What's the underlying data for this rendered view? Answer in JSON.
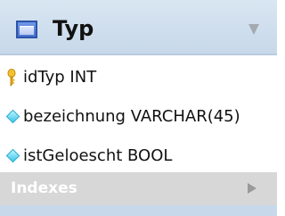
{
  "table": {
    "name": "Typ",
    "icon": "table-icon",
    "collapse_icon": "collapse-arrow-icon"
  },
  "columns": [
    {
      "label": "idTyp INT",
      "icon": "primary-key-icon"
    },
    {
      "label": "bezeichnung VARCHAR(45)",
      "icon": "column-diamond-icon"
    },
    {
      "label": "istGeloescht BOOL",
      "icon": "column-diamond-icon"
    }
  ],
  "indexes": {
    "label": "Indexes",
    "icon": "expand-arrow-icon"
  },
  "colors": {
    "header": "#c7d8ea",
    "table_icon": "#4c73d2",
    "key_icon": "#f2b51d",
    "column_icon": "#39c3e7",
    "indexes_background": "#d7d7d7"
  }
}
